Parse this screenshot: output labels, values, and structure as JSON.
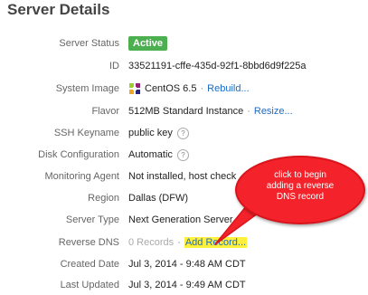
{
  "title": "Server Details",
  "rows": [
    {
      "label": "Server Status",
      "badge": "Active"
    },
    {
      "label": "ID",
      "value": "33521191-cffe-435d-92f1-8bbd6d9f225a"
    },
    {
      "label": "System Image",
      "value": "CentOS 6.5",
      "link": "Rebuild..."
    },
    {
      "label": "Flavor",
      "value": "512MB Standard Instance",
      "link": "Resize..."
    },
    {
      "label": "SSH Keyname",
      "value": "public key"
    },
    {
      "label": "Disk Configuration",
      "value": "Automatic"
    },
    {
      "label": "Monitoring Agent",
      "value": "Not installed, host check"
    },
    {
      "label": "Region",
      "value": "Dallas (DFW)"
    },
    {
      "label": "Server Type",
      "value": "Next Generation Server"
    },
    {
      "label": "Reverse DNS",
      "value": "0 Records",
      "link": "Add Record..."
    },
    {
      "label": "Created Date",
      "value": "Jul 3, 2014 - 9:48 AM CDT"
    },
    {
      "label": "Last Updated",
      "value": "Jul 3, 2014 - 9:49 AM CDT"
    }
  ],
  "help_glyph": "?",
  "separator": "·",
  "callout": {
    "line1": "click to begin",
    "line2": "adding a reverse",
    "line3": "DNS record",
    "color": "#f4222a"
  },
  "colors": {
    "accent": "#1a6bc4",
    "active": "#4caf50",
    "highlight": "#fff03c"
  }
}
